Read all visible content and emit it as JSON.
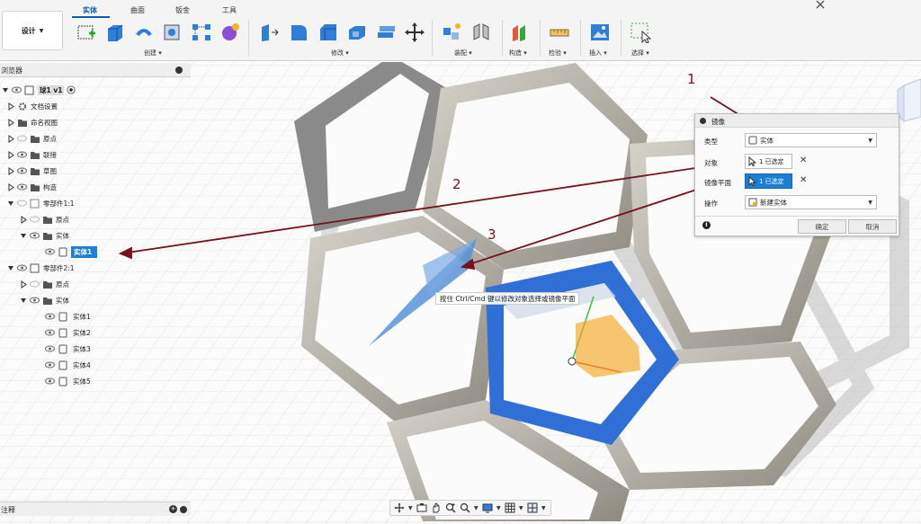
{
  "workspace": {
    "label": "设计",
    "caret": "▼"
  },
  "tabs": [
    {
      "label": "实体",
      "active": true
    },
    {
      "label": "曲面",
      "active": false
    },
    {
      "label": "钣金",
      "active": false
    },
    {
      "label": "工具",
      "active": false
    }
  ],
  "toolbar_groups": [
    {
      "label": "创建 ▾"
    },
    {
      "label": "修改 ▾"
    },
    {
      "label": "装配 ▾"
    },
    {
      "label": "构造 ▾"
    },
    {
      "label": "检验 ▾"
    },
    {
      "label": "插入 ▾"
    },
    {
      "label": "选择 ▾"
    }
  ],
  "browser": {
    "title": "浏览器",
    "root": {
      "label": "球1 v1"
    },
    "items": [
      {
        "label": "文档设置"
      },
      {
        "label": "命名视图"
      },
      {
        "label": "原点"
      },
      {
        "label": "联接"
      },
      {
        "label": "草图"
      },
      {
        "label": "构造"
      },
      {
        "label": "零部件1:1"
      },
      {
        "label": "原点"
      },
      {
        "label": "实体"
      },
      {
        "label": "实体1"
      },
      {
        "label": "零部件2:1"
      },
      {
        "label": "原点"
      },
      {
        "label": "实体"
      },
      {
        "label": "实体1"
      },
      {
        "label": "实体2"
      },
      {
        "label": "实体3"
      },
      {
        "label": "实体4"
      },
      {
        "label": "实体5"
      }
    ]
  },
  "comments": {
    "title": "注释"
  },
  "dialog": {
    "title": "镜像",
    "type_label": "类型",
    "type_value": "实体",
    "objects_label": "对象",
    "objects_value": "1 已选定",
    "plane_label": "镜像平面",
    "plane_value": "1 已选定",
    "operation_label": "操作",
    "operation_value": "新建实体",
    "ok_label": "确定",
    "cancel_label": "取消"
  },
  "tooltip": "按住 Ctrl/Cmd 键以修改对象选择或镜像平面",
  "callouts": [
    "1",
    "2",
    "3"
  ],
  "colors": {
    "accent": "#1c7fd6",
    "annotation": "#7a0f1e",
    "selected_face": "#2f6fd6",
    "mirror_plane": "#4f8fd8",
    "body_grey": "#b8b4aa",
    "highlight_orange": "#f5a623"
  }
}
